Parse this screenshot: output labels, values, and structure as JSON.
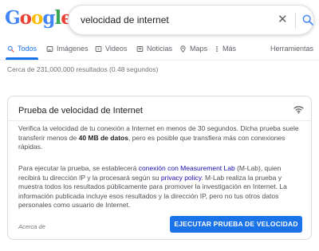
{
  "logo": {
    "letters": [
      "G",
      "o",
      "o",
      "g",
      "l",
      "e"
    ],
    "colors": [
      "#4285f4",
      "#ea4335",
      "#fbbc05",
      "#4285f4",
      "#34a853",
      "#ea4335"
    ]
  },
  "search": {
    "query": "velocidad de internet",
    "clear_icon": "close-icon",
    "search_icon": "search-icon"
  },
  "tabs": [
    {
      "label": "Todos",
      "icon": "search-icon",
      "active": true
    },
    {
      "label": "Imágenes",
      "icon": "image-icon"
    },
    {
      "label": "Videos",
      "icon": "video-icon"
    },
    {
      "label": "Noticias",
      "icon": "news-icon"
    },
    {
      "label": "Maps",
      "icon": "map-pin-icon"
    },
    {
      "label": "Más",
      "icon": "more-icon"
    },
    {
      "label": "Herramientas"
    }
  ],
  "stats": "Cerca de 231,000,000 resultados (0.48 segundos)",
  "card": {
    "title": "Prueba de velocidad de Internet",
    "icon": "wifi-icon",
    "para1_a": "Verifica la velocidad de tu conexión a Internet en menos de 30 segundos. Dicha prueba suele transferir menos de ",
    "para1_bold": "40 MB de datos",
    "para1_b": ", pero es posible que transfiera más con conexiones rápidas.",
    "para2_a": "Para ejecutar la prueba, se establecerá ",
    "para2_link1": "conexión con Measurement Lab",
    "para2_b": " (M-Lab), quien recibirá tu dirección IP y la procesará según su ",
    "para2_link2": "privacy policy",
    "para2_c": ". M-Lab realiza la prueba y muestra todos los resultados públicamente para promover la investigación en Internet. La información publicada incluye esos resultados y la dirección IP, pero no tus otros datos personales como usuario de Internet.",
    "about": "Acerca de",
    "button": "EJECUTAR PRUEBA DE VELOCIDAD"
  },
  "colors": {
    "accent": "#1a73e8",
    "link": "#1a0dab"
  }
}
